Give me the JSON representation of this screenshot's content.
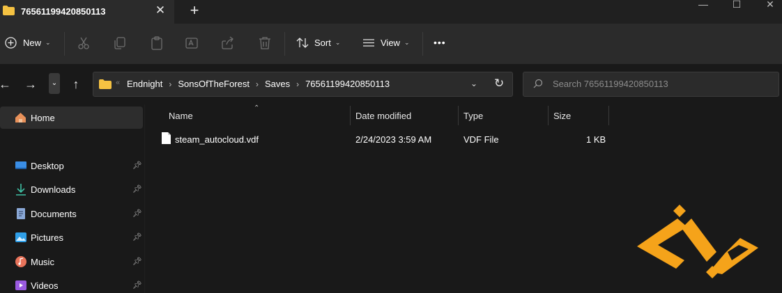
{
  "window": {
    "tab_title": "76561199420850113",
    "tab_close_glyph": "✕",
    "new_tab_glyph": "+",
    "controls": {
      "minimize": "—",
      "maximize": "☐",
      "close": "✕"
    }
  },
  "command_bar": {
    "new_label": "New",
    "sort_label": "Sort",
    "view_label": "View",
    "more_glyph": "•••",
    "icons": [
      "cut-icon",
      "copy-icon",
      "paste-icon",
      "rename-icon",
      "share-icon",
      "delete-icon"
    ]
  },
  "address": {
    "breadcrumbs": [
      "Endnight",
      "SonsOfTheForest",
      "Saves",
      "76561199420850113"
    ],
    "crumb_separator": "›",
    "lead_separator": "«",
    "search_placeholder": "Search 76561199420850113"
  },
  "sidebar": {
    "home_label": "Home",
    "items": [
      {
        "label": "Desktop",
        "icon": "desktop-icon",
        "color": "#3a8ee6"
      },
      {
        "label": "Downloads",
        "icon": "download-icon",
        "color": "#3fc1a5"
      },
      {
        "label": "Documents",
        "icon": "document-icon",
        "color": "#8aa8d6"
      },
      {
        "label": "Pictures",
        "icon": "pictures-icon",
        "color": "#2f9fe8"
      },
      {
        "label": "Music",
        "icon": "music-icon",
        "color": "#e8735a"
      },
      {
        "label": "Videos",
        "icon": "videos-icon",
        "color": "#9a5ae0"
      }
    ]
  },
  "file_list": {
    "columns": {
      "name": "Name",
      "date": "Date modified",
      "type": "Type",
      "size": "Size"
    },
    "rows": [
      {
        "name": "steam_autocloud.vdf",
        "date": "2/24/2023 3:59 AM",
        "type": "VDF File",
        "size": "1 KB"
      }
    ]
  },
  "colors": {
    "background": "#191919",
    "toolbar": "#2b2b2b",
    "folder_yellow": "#f5c242",
    "logo_orange": "#f5a31a"
  }
}
